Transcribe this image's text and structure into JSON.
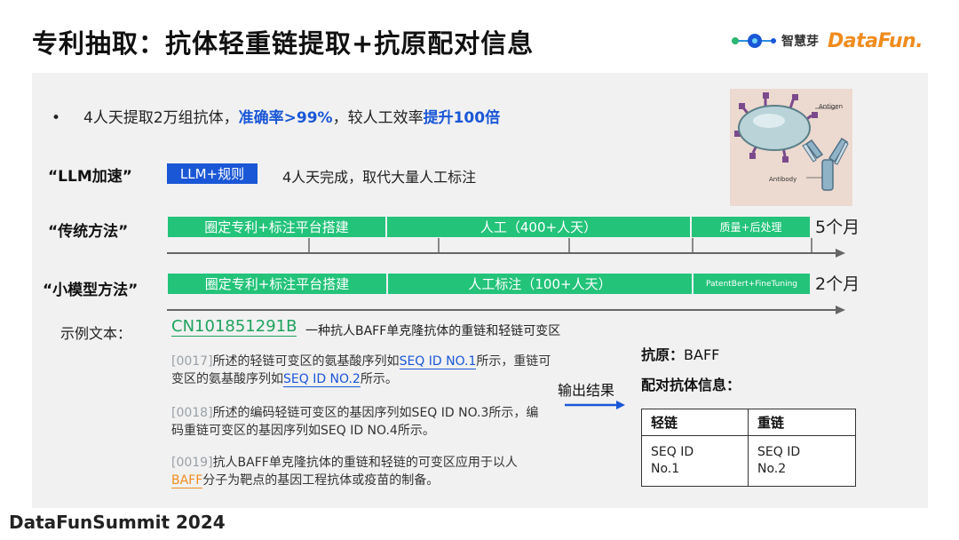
{
  "title": "专利抽取：抗体轻重链提取+抗原配对信息",
  "logos": {
    "zhihuiya": "智慧芽",
    "datafun": "DataFun."
  },
  "bullet": {
    "dot": "•",
    "prefix": "4人天提取2万组抗体，",
    "hl1": "准确率>99%",
    "middle": "，较人工效率",
    "hl2": "提升100倍"
  },
  "llm": {
    "label": "“LLM加速”",
    "tag": "LLM+规则",
    "desc": "4人天完成，取代大量人工标注"
  },
  "traditional": {
    "label": "“传统方法”",
    "segments": [
      "圈定专利+标注平台搭建",
      "人工（400+人天）",
      "质量+后处理"
    ],
    "duration": "5个月"
  },
  "small_model": {
    "label": "“小模型方法”",
    "segments": [
      "圈定专利+标注平台搭建",
      "人工标注（100+人天）",
      "PatentBert+FineTuning"
    ],
    "duration": "2个月"
  },
  "example": {
    "label": "示例文本：",
    "patent_id": "CN101851291B",
    "patent_title": "一种抗人BAFF单克隆抗体的重链和轻链可变区",
    "p1": {
      "ref": "[0017]",
      "t1": "所述的轻链可变区的氨基酸序列如",
      "s1": "SEQ ID NO.1",
      "t2": "所示，重链可变区的氨基酸序列如",
      "s2": "SEQ ID NO.2",
      "t3": "所示。"
    },
    "p2": {
      "ref": "[0018]",
      "text": "所述的编码轻链可变区的基因序列如SEQ ID NO.3所示，编码重链可变区的基因序列如SEQ ID NO.4所示。"
    },
    "p3": {
      "ref": "[0019]",
      "t1": "抗人BAFF单克隆抗体的重链和轻链的可变区应用于以人",
      "baff": "BAFF",
      "t2": "分子为靶点的基因工程抗体或疫苗的制备。"
    }
  },
  "output": {
    "label": "输出结果",
    "antigen_key": "抗原：",
    "antigen_value": "BAFF",
    "pair_label": "配对抗体信息：",
    "headers": [
      "轻链",
      "重链"
    ],
    "cells": [
      [
        "SEQ ID",
        "No.1"
      ],
      [
        "SEQ ID",
        "No.2"
      ]
    ]
  },
  "image": {
    "antigen_label": "Antigen",
    "antibody_label": "Antibody"
  },
  "footer": "DataFunSummit 2024",
  "colors": {
    "blue": "#1a57d6",
    "green": "#23c37a",
    "orange": "#f08c1e",
    "panel": "#f1f1f1"
  }
}
